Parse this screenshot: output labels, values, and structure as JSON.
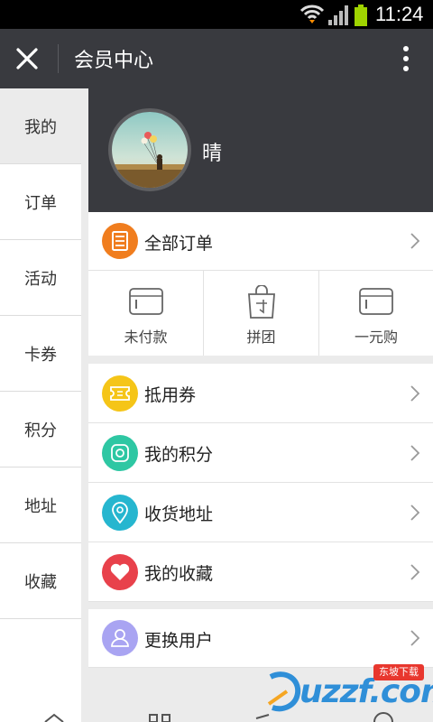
{
  "status_bar": {
    "time": "11:24"
  },
  "header": {
    "title": "会员中心"
  },
  "sidebar": {
    "items": [
      {
        "label": "我的"
      },
      {
        "label": "订单"
      },
      {
        "label": "活动"
      },
      {
        "label": "卡券"
      },
      {
        "label": "积分"
      },
      {
        "label": "地址"
      },
      {
        "label": "收藏"
      }
    ]
  },
  "profile": {
    "name": "晴"
  },
  "orders": {
    "all_label": "全部订单",
    "tabs": [
      {
        "label": "未付款"
      },
      {
        "label": "拼团"
      },
      {
        "label": "一元购"
      }
    ]
  },
  "menu": [
    {
      "label": "抵用券",
      "color": "#f5c518"
    },
    {
      "label": "我的积分",
      "color": "#2ec7a3"
    },
    {
      "label": "收货地址",
      "color": "#26b6cf"
    },
    {
      "label": "我的收藏",
      "color": "#e8414b"
    }
  ],
  "switch_user": {
    "label": "更换用户",
    "color": "#a9a4f2"
  },
  "colors": {
    "titlebar": "#393a3f",
    "orders_icon": "#f07d1e"
  },
  "watermark": {
    "text": "uzzf.com",
    "badge": "东坡下载"
  }
}
